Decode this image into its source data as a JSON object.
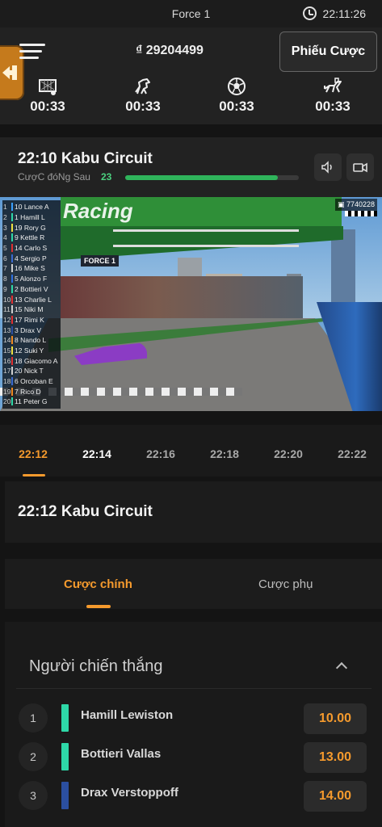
{
  "status": {
    "title": "Force 1",
    "clock": "22:11:26"
  },
  "header": {
    "balance": "₫ 29204499",
    "ticket_label": "Phiếu Cược",
    "sports": [
      {
        "icon": "football-goal-icon",
        "time": "00:33"
      },
      {
        "icon": "horse-racing-icon",
        "time": "00:33"
      },
      {
        "icon": "soccer-ball-icon",
        "time": "00:33"
      },
      {
        "icon": "greyhound-racing-icon",
        "time": "00:33"
      }
    ]
  },
  "current_race": {
    "title": "22:10 Kabu Circuit",
    "closing_label": "CượC đóNg Sau",
    "closing_count": "23",
    "closing_progress": 0.88
  },
  "video": {
    "stream_id": "7740228",
    "banner_text": "Racing",
    "sign_text": "FORCE 1",
    "leaderboard": [
      {
        "pos": "1",
        "label": "10 Lance A",
        "color": "#3aa0ff"
      },
      {
        "pos": "2",
        "label": "1 Hamill L",
        "color": "#2ed8a8"
      },
      {
        "pos": "3",
        "label": "19 Rory G",
        "color": "#f0e040"
      },
      {
        "pos": "4",
        "label": "9 Kettle R",
        "color": "#2ed8a8"
      },
      {
        "pos": "5",
        "label": "14 Carlo S",
        "color": "#e03030"
      },
      {
        "pos": "6",
        "label": "4 Sergio P",
        "color": "#3a6ad0"
      },
      {
        "pos": "7",
        "label": "16 Mike S",
        "color": "#cfcfcf"
      },
      {
        "pos": "8",
        "label": "5 Alonzo F",
        "color": "#2e70e0"
      },
      {
        "pos": "9",
        "label": "2 Bottieri V",
        "color": "#2ed8a8"
      },
      {
        "pos": "10",
        "label": "13 Charlie L",
        "color": "#e03030"
      },
      {
        "pos": "11",
        "label": "15 Niki M",
        "color": "#cfcfcf"
      },
      {
        "pos": "12",
        "label": "17 Rimi K",
        "color": "#e03030"
      },
      {
        "pos": "13",
        "label": "3 Drax V",
        "color": "#2b4fa0"
      },
      {
        "pos": "14",
        "label": "8 Nando L",
        "color": "#f08a20"
      },
      {
        "pos": "15",
        "label": "12 Suki Y",
        "color": "#f0e040"
      },
      {
        "pos": "16",
        "label": "18 Giacomo A",
        "color": "#e03030"
      },
      {
        "pos": "17",
        "label": "20 Nick T",
        "color": "#cfcfcf"
      },
      {
        "pos": "18",
        "label": "6 Orcoban E",
        "color": "#3a6ad0"
      },
      {
        "pos": "19",
        "label": "7 Rico D",
        "color": "#f08a20"
      },
      {
        "pos": "20",
        "label": "11 Peter G",
        "color": "#2ed8a8"
      }
    ]
  },
  "schedule": {
    "times": [
      "22:12",
      "22:14",
      "22:16",
      "22:18",
      "22:20",
      "22:22"
    ]
  },
  "selected_race": {
    "title": "22:12 Kabu Circuit"
  },
  "bet_tabs": {
    "main": "Cược chính",
    "side": "Cược phụ"
  },
  "winner_market": {
    "title": "Người chiến thắng",
    "runners": [
      {
        "num": "1",
        "name": "Hamill Lewiston",
        "odds": "10.00",
        "color": "#2ed8a8"
      },
      {
        "num": "2",
        "name": "Bottieri Vallas",
        "odds": "13.00",
        "color": "#2ed8a8"
      },
      {
        "num": "3",
        "name": "Drax Verstoppoff",
        "odds": "14.00",
        "color": "#2b4fa0"
      }
    ]
  },
  "colors": {
    "accent": "#f59a2d",
    "success": "#2fb45b",
    "background": "#141414"
  }
}
